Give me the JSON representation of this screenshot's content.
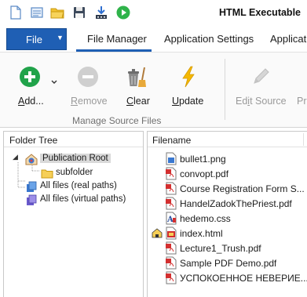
{
  "window": {
    "title": "HTML Executable"
  },
  "quick_access": {
    "buttons": [
      {
        "name": "new-file-icon"
      },
      {
        "name": "properties-icon"
      },
      {
        "name": "open-folder-icon"
      },
      {
        "name": "save-icon"
      },
      {
        "name": "build-icon"
      },
      {
        "name": "run-icon"
      }
    ]
  },
  "tabs": {
    "file": "File",
    "items": [
      "File Manager",
      "Application Settings",
      "Applicatio"
    ],
    "active": "File Manager"
  },
  "ribbon": {
    "buttons": {
      "add": {
        "label_u": "A",
        "label_rest": "dd...",
        "enabled": true
      },
      "remove": {
        "label_u": "R",
        "label_rest": "emove",
        "enabled": false
      },
      "clear": {
        "label_u": "C",
        "label_rest": "lear",
        "enabled": true
      },
      "update": {
        "label_u": "U",
        "label_rest": "pdate",
        "enabled": true
      },
      "edit_source": {
        "label_pre": "Ed",
        "label_u": "i",
        "label_rest": "t Source",
        "enabled": false
      },
      "prev": {
        "label": "Pr",
        "enabled": false
      }
    },
    "group_label": "Manage Source Files"
  },
  "tree": {
    "header": "Folder Tree",
    "nodes": [
      {
        "label": "Publication Root",
        "selected": true,
        "expanded": true,
        "icon": "publication-root-icon"
      },
      {
        "label": "subfolder",
        "icon": "folder-icon"
      },
      {
        "label": "All files (real paths)",
        "icon": "all-files-real-icon"
      },
      {
        "label": "All files (virtual paths)",
        "icon": "all-files-virtual-icon"
      }
    ]
  },
  "files": {
    "header": "Filename",
    "items": [
      {
        "name": "bullet1.png",
        "type": "png"
      },
      {
        "name": "convopt.pdf",
        "type": "pdf"
      },
      {
        "name": "Course Registration Form S...",
        "type": "pdf"
      },
      {
        "name": "HandelZadokThePriest.pdf",
        "type": "pdf"
      },
      {
        "name": "hedemo.css",
        "type": "css"
      },
      {
        "name": "index.html",
        "type": "html",
        "homepage": true
      },
      {
        "name": "Lecture1_Trush.pdf",
        "type": "pdf"
      },
      {
        "name": "Sample PDF Demo.pdf",
        "type": "pdf"
      },
      {
        "name": "УСПОКОЕННОЕ НЕВЕРИЕ...",
        "type": "pdf"
      }
    ]
  },
  "colors": {
    "accent": "#1f5fb4",
    "add_green": "#21a34a",
    "update_yellow": "#f5b800",
    "disabled": "#b8b8b8"
  }
}
